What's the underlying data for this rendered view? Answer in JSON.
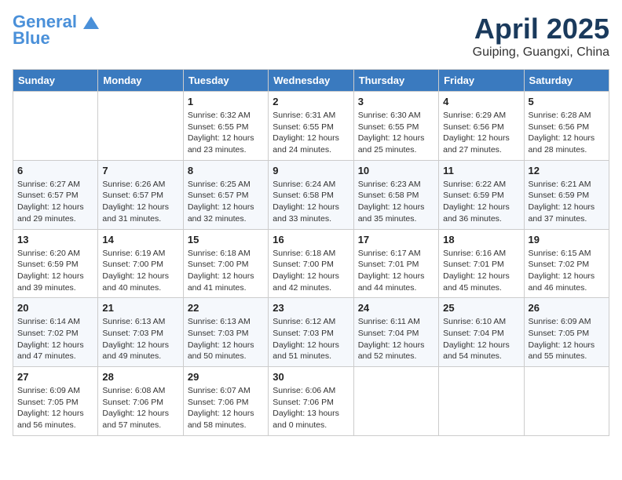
{
  "header": {
    "logo_line1": "General",
    "logo_line2": "Blue",
    "month": "April 2025",
    "location": "Guiping, Guangxi, China"
  },
  "weekdays": [
    "Sunday",
    "Monday",
    "Tuesday",
    "Wednesday",
    "Thursday",
    "Friday",
    "Saturday"
  ],
  "weeks": [
    [
      {
        "day": "",
        "sunrise": "",
        "sunset": "",
        "daylight": ""
      },
      {
        "day": "",
        "sunrise": "",
        "sunset": "",
        "daylight": ""
      },
      {
        "day": "1",
        "sunrise": "Sunrise: 6:32 AM",
        "sunset": "Sunset: 6:55 PM",
        "daylight": "Daylight: 12 hours and 23 minutes."
      },
      {
        "day": "2",
        "sunrise": "Sunrise: 6:31 AM",
        "sunset": "Sunset: 6:55 PM",
        "daylight": "Daylight: 12 hours and 24 minutes."
      },
      {
        "day": "3",
        "sunrise": "Sunrise: 6:30 AM",
        "sunset": "Sunset: 6:55 PM",
        "daylight": "Daylight: 12 hours and 25 minutes."
      },
      {
        "day": "4",
        "sunrise": "Sunrise: 6:29 AM",
        "sunset": "Sunset: 6:56 PM",
        "daylight": "Daylight: 12 hours and 27 minutes."
      },
      {
        "day": "5",
        "sunrise": "Sunrise: 6:28 AM",
        "sunset": "Sunset: 6:56 PM",
        "daylight": "Daylight: 12 hours and 28 minutes."
      }
    ],
    [
      {
        "day": "6",
        "sunrise": "Sunrise: 6:27 AM",
        "sunset": "Sunset: 6:57 PM",
        "daylight": "Daylight: 12 hours and 29 minutes."
      },
      {
        "day": "7",
        "sunrise": "Sunrise: 6:26 AM",
        "sunset": "Sunset: 6:57 PM",
        "daylight": "Daylight: 12 hours and 31 minutes."
      },
      {
        "day": "8",
        "sunrise": "Sunrise: 6:25 AM",
        "sunset": "Sunset: 6:57 PM",
        "daylight": "Daylight: 12 hours and 32 minutes."
      },
      {
        "day": "9",
        "sunrise": "Sunrise: 6:24 AM",
        "sunset": "Sunset: 6:58 PM",
        "daylight": "Daylight: 12 hours and 33 minutes."
      },
      {
        "day": "10",
        "sunrise": "Sunrise: 6:23 AM",
        "sunset": "Sunset: 6:58 PM",
        "daylight": "Daylight: 12 hours and 35 minutes."
      },
      {
        "day": "11",
        "sunrise": "Sunrise: 6:22 AM",
        "sunset": "Sunset: 6:59 PM",
        "daylight": "Daylight: 12 hours and 36 minutes."
      },
      {
        "day": "12",
        "sunrise": "Sunrise: 6:21 AM",
        "sunset": "Sunset: 6:59 PM",
        "daylight": "Daylight: 12 hours and 37 minutes."
      }
    ],
    [
      {
        "day": "13",
        "sunrise": "Sunrise: 6:20 AM",
        "sunset": "Sunset: 6:59 PM",
        "daylight": "Daylight: 12 hours and 39 minutes."
      },
      {
        "day": "14",
        "sunrise": "Sunrise: 6:19 AM",
        "sunset": "Sunset: 7:00 PM",
        "daylight": "Daylight: 12 hours and 40 minutes."
      },
      {
        "day": "15",
        "sunrise": "Sunrise: 6:18 AM",
        "sunset": "Sunset: 7:00 PM",
        "daylight": "Daylight: 12 hours and 41 minutes."
      },
      {
        "day": "16",
        "sunrise": "Sunrise: 6:18 AM",
        "sunset": "Sunset: 7:00 PM",
        "daylight": "Daylight: 12 hours and 42 minutes."
      },
      {
        "day": "17",
        "sunrise": "Sunrise: 6:17 AM",
        "sunset": "Sunset: 7:01 PM",
        "daylight": "Daylight: 12 hours and 44 minutes."
      },
      {
        "day": "18",
        "sunrise": "Sunrise: 6:16 AM",
        "sunset": "Sunset: 7:01 PM",
        "daylight": "Daylight: 12 hours and 45 minutes."
      },
      {
        "day": "19",
        "sunrise": "Sunrise: 6:15 AM",
        "sunset": "Sunset: 7:02 PM",
        "daylight": "Daylight: 12 hours and 46 minutes."
      }
    ],
    [
      {
        "day": "20",
        "sunrise": "Sunrise: 6:14 AM",
        "sunset": "Sunset: 7:02 PM",
        "daylight": "Daylight: 12 hours and 47 minutes."
      },
      {
        "day": "21",
        "sunrise": "Sunrise: 6:13 AM",
        "sunset": "Sunset: 7:03 PM",
        "daylight": "Daylight: 12 hours and 49 minutes."
      },
      {
        "day": "22",
        "sunrise": "Sunrise: 6:13 AM",
        "sunset": "Sunset: 7:03 PM",
        "daylight": "Daylight: 12 hours and 50 minutes."
      },
      {
        "day": "23",
        "sunrise": "Sunrise: 6:12 AM",
        "sunset": "Sunset: 7:03 PM",
        "daylight": "Daylight: 12 hours and 51 minutes."
      },
      {
        "day": "24",
        "sunrise": "Sunrise: 6:11 AM",
        "sunset": "Sunset: 7:04 PM",
        "daylight": "Daylight: 12 hours and 52 minutes."
      },
      {
        "day": "25",
        "sunrise": "Sunrise: 6:10 AM",
        "sunset": "Sunset: 7:04 PM",
        "daylight": "Daylight: 12 hours and 54 minutes."
      },
      {
        "day": "26",
        "sunrise": "Sunrise: 6:09 AM",
        "sunset": "Sunset: 7:05 PM",
        "daylight": "Daylight: 12 hours and 55 minutes."
      }
    ],
    [
      {
        "day": "27",
        "sunrise": "Sunrise: 6:09 AM",
        "sunset": "Sunset: 7:05 PM",
        "daylight": "Daylight: 12 hours and 56 minutes."
      },
      {
        "day": "28",
        "sunrise": "Sunrise: 6:08 AM",
        "sunset": "Sunset: 7:06 PM",
        "daylight": "Daylight: 12 hours and 57 minutes."
      },
      {
        "day": "29",
        "sunrise": "Sunrise: 6:07 AM",
        "sunset": "Sunset: 7:06 PM",
        "daylight": "Daylight: 12 hours and 58 minutes."
      },
      {
        "day": "30",
        "sunrise": "Sunrise: 6:06 AM",
        "sunset": "Sunset: 7:06 PM",
        "daylight": "Daylight: 13 hours and 0 minutes."
      },
      {
        "day": "",
        "sunrise": "",
        "sunset": "",
        "daylight": ""
      },
      {
        "day": "",
        "sunrise": "",
        "sunset": "",
        "daylight": ""
      },
      {
        "day": "",
        "sunrise": "",
        "sunset": "",
        "daylight": ""
      }
    ]
  ]
}
